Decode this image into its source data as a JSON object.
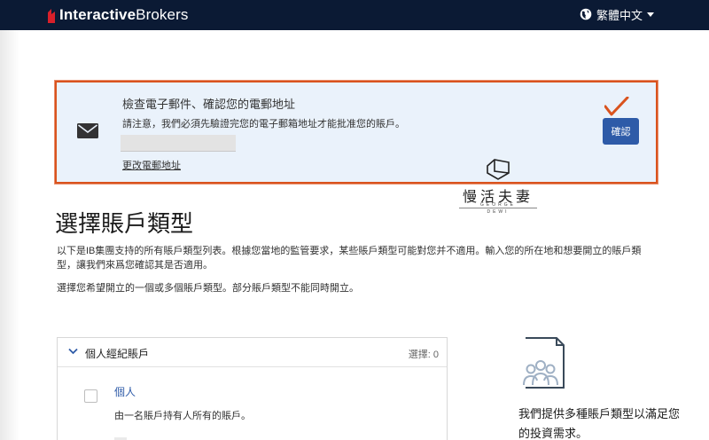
{
  "header": {
    "brand_bold": "Interactive",
    "brand_light": "Brokers",
    "language": "繁體中文"
  },
  "verify": {
    "title": "檢查電子郵件、確認您的電郵地址",
    "note": "請注意，我們必須先驗證完您的電子郵箱地址才能批准您的賬戶。",
    "change_email": "更改電郵地址",
    "confirm_button": "確認"
  },
  "watermark": {
    "name": "慢活夫妻",
    "sub1": "GEORGE",
    "sub2": "DEWI"
  },
  "main": {
    "title": "選擇賬戶類型",
    "intro": "以下是IB集團支持的所有賬戶類型列表。根據您當地的監管要求，某些賬戶類型可能對您并不適用。輸入您的所在地和想要開立的賬戶類型，讓我們來爲您確認其是否適用。",
    "intro2": "選擇您希望開立的一個或多個賬戶類型。部分賬戶類型不能同時開立。"
  },
  "panel": {
    "title": "個人經紀賬戶",
    "selected": "選擇: 0",
    "account_name": "個人",
    "account_desc": "由一名賬戶持有人所有的賬戶。"
  },
  "promo": {
    "text": "我們提供多種賬戶類型以滿足您的投資需求。"
  },
  "colors": {
    "topbar": "#0b1a34",
    "accent": "#2e5ba8",
    "highlight_border": "#d9531e",
    "verify_bg": "#eaf2fb"
  }
}
